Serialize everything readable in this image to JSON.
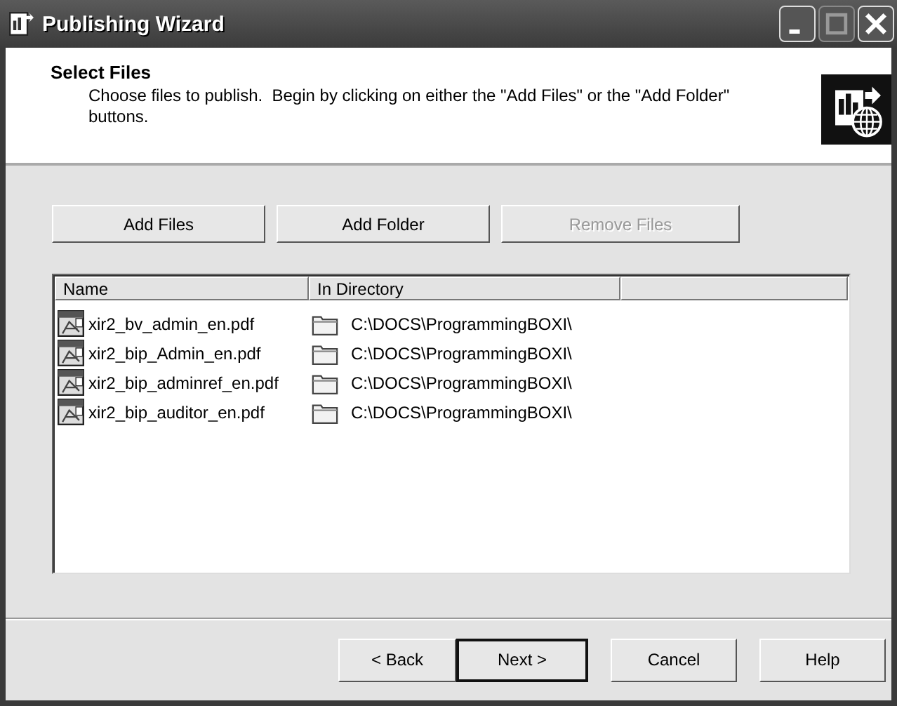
{
  "window": {
    "title": "Publishing Wizard"
  },
  "header": {
    "title": "Select Files",
    "description": "Choose files to publish.  Begin by clicking on either the \"Add Files\" or the \"Add Folder\" buttons."
  },
  "actions": [
    {
      "label": "Add Files",
      "disabled": false
    },
    {
      "label": "Add Folder",
      "disabled": false
    },
    {
      "label": "Remove Files",
      "disabled": true
    }
  ],
  "file_list": {
    "columns": [
      "Name",
      "In Directory"
    ],
    "rows": [
      {
        "name": "xir2_bv_admin_en.pdf",
        "directory": "C:\\DOCS\\ProgrammingBOXI\\"
      },
      {
        "name": "xir2_bip_Admin_en.pdf",
        "directory": "C:\\DOCS\\ProgrammingBOXI\\"
      },
      {
        "name": "xir2_bip_adminref_en.pdf",
        "directory": "C:\\DOCS\\ProgrammingBOXI\\"
      },
      {
        "name": "xir2_bip_auditor_en.pdf",
        "directory": "C:\\DOCS\\ProgrammingBOXI\\"
      }
    ]
  },
  "nav_buttons": [
    {
      "label": "< Back",
      "default": false
    },
    {
      "label": "Next >",
      "default": true
    },
    {
      "label": "Cancel",
      "default": false
    },
    {
      "label": "Help",
      "default": false
    }
  ]
}
